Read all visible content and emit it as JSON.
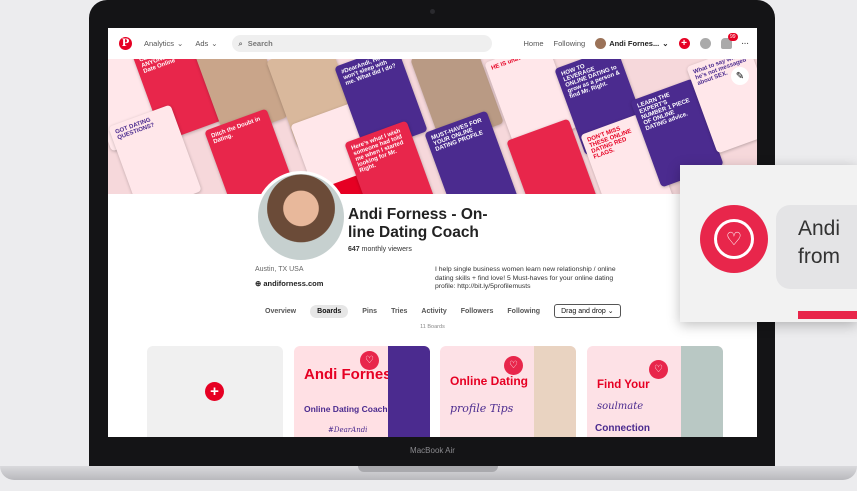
{
  "nav": {
    "logo": "P",
    "analytics": "Analytics",
    "ads": "Ads",
    "search_placeholder": "Search",
    "home": "Home",
    "following": "Following",
    "user": "Andi Fornes...",
    "notif_count": "99"
  },
  "cover": {
    "tiles": [
      "Can't Find ANYONE I Want to Date Online",
      "GOT DATING QUESTIONS?",
      "Ditch the Doubt in Dating.",
      "#DearAndi, He won't sleep with me. What did I do?",
      "Here's what I wish someone had told me when I started looking for Mr. Right.",
      "MUST-HAVES FOR YOUR ONLINE DATING PROFILE",
      "HE IS unavailable",
      "HOW TO LEVERAGE ONLINE DATING to grow as a person & find Mr. Right.",
      "DON'T MISS THESE ONLINE DATING RED FLAGS.",
      "LEARN THE EXPERT'S NUMBER 1 PIECE OF ONLINE DATING advice.",
      "What to say when he's not messaged about SEX."
    ]
  },
  "profile": {
    "name": "Andi Forness - On-line Dating Coach",
    "viewers_count": "647",
    "viewers_label": "monthly viewers",
    "location": "Austin, TX USA",
    "website": "andiforness.com",
    "bio": "I help single business women learn new relationship / online dating skills + find love! 5 Must-haves for your online dating profile: http://bit.ly/5profilemusts"
  },
  "tabs": [
    "Overview",
    "Boards",
    "Pins",
    "Tries",
    "Activity",
    "Followers",
    "Following"
  ],
  "sort_dropdown": "Drag and drop",
  "boards_count": "11 Boards",
  "boards": {
    "b1_title": "Andi Forness",
    "b1_sub": "Online Dating Coach",
    "b1_sig": "#DearAndi",
    "b2_title": "Online Dating",
    "b2_ital": "profile Tips",
    "b3_title": "Find Your",
    "b3_ital": "soulmate",
    "b3_conn": "Connection"
  },
  "laptop_label": "MacBook Air",
  "callout_text": "Andi\nfrom"
}
